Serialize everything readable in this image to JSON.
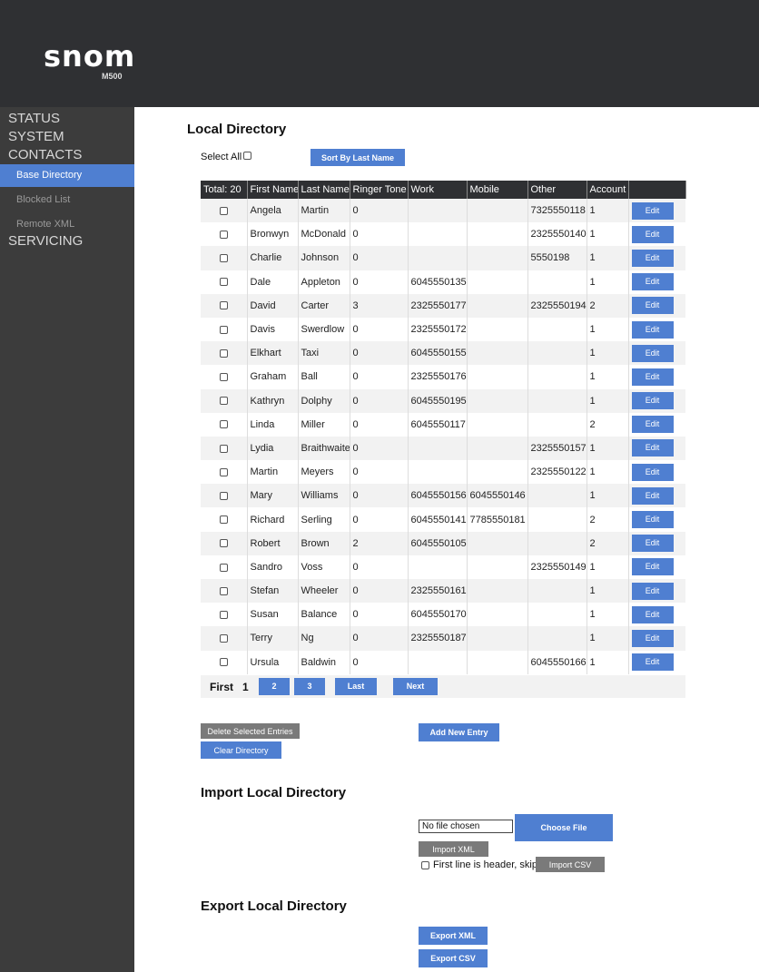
{
  "brand": {
    "name": "snom",
    "model": "M500"
  },
  "sidebar": {
    "sections": [
      {
        "label": "STATUS"
      },
      {
        "label": "SYSTEM"
      },
      {
        "label": "CONTACTS"
      }
    ],
    "items": [
      {
        "label": "Base Directory"
      },
      {
        "label": "Blocked List"
      },
      {
        "label": "Remote XML"
      }
    ],
    "servicing": "SERVICING"
  },
  "local_directory": {
    "title": "Local Directory",
    "select_all_label": "Select All",
    "sort_button": "Sort By Last Name",
    "columns": [
      "Total: 20",
      "First Name",
      "Last Name",
      "Ringer Tone",
      "Work",
      "Mobile",
      "Other",
      "Account",
      ""
    ],
    "edit_label": "Edit",
    "rows": [
      [
        "Angela",
        "Martin",
        "0",
        "",
        "",
        "7325550118",
        "1"
      ],
      [
        "Bronwyn",
        "McDonald",
        "0",
        "",
        "",
        "2325550140",
        "1"
      ],
      [
        "Charlie",
        "Johnson",
        "0",
        "",
        "",
        "5550198",
        "1"
      ],
      [
        "Dale",
        "Appleton",
        "0",
        "6045550135",
        "",
        "",
        "1"
      ],
      [
        "David",
        "Carter",
        "3",
        "2325550177",
        "",
        "2325550194",
        "2"
      ],
      [
        "Davis",
        "Swerdlow",
        "0",
        "2325550172",
        "",
        "",
        "1"
      ],
      [
        "Elkhart",
        "Taxi",
        "0",
        "6045550155",
        "",
        "",
        "1"
      ],
      [
        "Graham",
        "Ball",
        "0",
        "2325550176",
        "",
        "",
        "1"
      ],
      [
        "Kathryn",
        "Dolphy",
        "0",
        "6045550195",
        "",
        "",
        "1"
      ],
      [
        "Linda",
        "Miller",
        "0",
        "6045550117",
        "",
        "",
        "2"
      ],
      [
        "Lydia",
        "Braithwaite",
        "0",
        "",
        "",
        "2325550157",
        "1"
      ],
      [
        "Martin",
        "Meyers",
        "0",
        "",
        "",
        "2325550122",
        "1"
      ],
      [
        "Mary",
        "Williams",
        "0",
        "6045550156",
        "6045550146",
        "",
        "1"
      ],
      [
        "Richard",
        "Serling",
        "0",
        "6045550141",
        "7785550181",
        "",
        "2"
      ],
      [
        "Robert",
        "Brown",
        "2",
        "6045550105",
        "",
        "",
        "2"
      ],
      [
        "Sandro",
        "Voss",
        "0",
        "",
        "",
        "2325550149",
        "1"
      ],
      [
        "Stefan",
        "Wheeler",
        "0",
        "2325550161",
        "",
        "",
        "1"
      ],
      [
        "Susan",
        "Balance",
        "0",
        "6045550170",
        "",
        "",
        "1"
      ],
      [
        "Terry",
        "Ng",
        "0",
        "2325550187",
        "",
        "",
        "1"
      ],
      [
        "Ursula",
        "Baldwin",
        "0",
        "",
        "",
        "6045550166",
        "1"
      ]
    ],
    "pagination": {
      "first": "First",
      "current": "1",
      "page2": "2",
      "page3": "3",
      "last": "Last",
      "next": "Next"
    },
    "delete_button": "Delete Selected Entries",
    "clear_button": "Clear Directory",
    "add_button": "Add New Entry"
  },
  "import": {
    "title": "Import Local Directory",
    "file_status": "No file chosen",
    "choose_button": "Choose File",
    "import_xml_button": "Import XML",
    "header_skip_label": "First line is header, skip",
    "import_csv_button": "Import CSV"
  },
  "export": {
    "title": "Export Local Directory",
    "export_xml_button": "Export XML",
    "export_csv_button": "Export CSV"
  }
}
